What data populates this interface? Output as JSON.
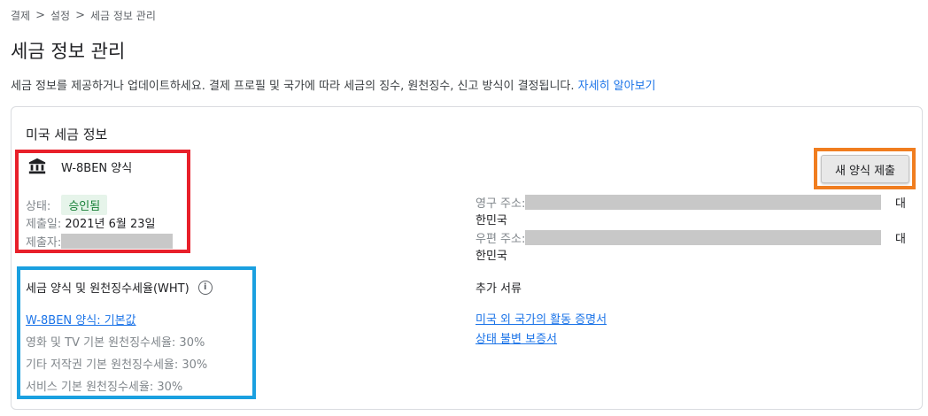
{
  "breadcrumb": {
    "items": [
      "결제",
      "설정",
      "세금 정보 관리"
    ],
    "separator": ">"
  },
  "page": {
    "title": "세금 정보 관리",
    "description": "세금 정보를 제공하거나 업데이트하세요. 결제 프로필 및 국가에 따라 세금의 징수, 원천징수, 신고 방식이 결정됩니다.",
    "learn_more": "자세히 알아보기"
  },
  "card": {
    "title": "미국 세금 정보",
    "form": {
      "icon": "bank-icon",
      "name": "W-8BEN 양식",
      "status_label": "상태:",
      "status_value": "승인됨",
      "submitted_label": "제출일:",
      "submitted_value": "2021년 6월 23일",
      "submitter_label": "제출자:"
    },
    "new_form_button": "새 양식 제출",
    "address": {
      "permanent_label": "영구 주소:",
      "permanent_tail": "대",
      "permanent_country": "한민국",
      "mailing_label": "우편 주소:",
      "mailing_tail": "대",
      "mailing_country": "한민국"
    },
    "wht": {
      "title": "세금 양식 및 원천징수세율(WHT)",
      "info_icon": "info-icon",
      "default_link": "W-8BEN 양식: 기본값",
      "items": [
        "영화 및 TV 기본 원천징수세율: 30%",
        "기타 저작권 기본 원천징수세율: 30%",
        "서비스 기본 원천징수세율: 30%"
      ]
    },
    "extra_docs": {
      "title": "추가 서류",
      "links": [
        "미국 외 국가의 활동 증명서",
        "상태 불변 보증서"
      ]
    }
  },
  "colors": {
    "link": "#1a73e8",
    "badge_bg": "#e6f4ea",
    "badge_text": "#188038",
    "annotation_red": "#e8202a",
    "annotation_blue": "#1aa0e0",
    "annotation_orange": "#f07d1f"
  }
}
